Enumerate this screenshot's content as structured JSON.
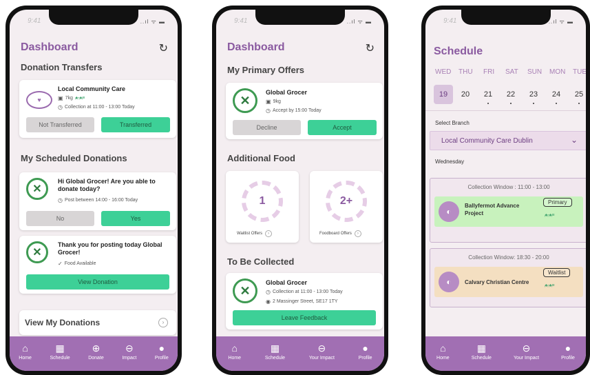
{
  "status": {
    "time": "9:41",
    "signal": "..ıl ᯤ ▬"
  },
  "phone1": {
    "title": "Dashboard",
    "section_transfers": "Donation Transfers",
    "transfer_card": {
      "name": "Local Community Care",
      "weight": "7kg",
      "collection": "Collection at 11:00 - 13:00 Today",
      "btn_not": "Not Transferred",
      "btn_yes": "Transferred"
    },
    "section_scheduled": "My Scheduled Donations",
    "scheduled_card1": {
      "title": "Hi Global Grocer! Are you able to donate today?",
      "line": "Post between 14:00 - 16:00 Today",
      "btn_no": "No",
      "btn_yes": "Yes"
    },
    "scheduled_card2": {
      "title": "Thank you for posting today Global Grocer!",
      "line": "Food Available",
      "btn": "View Donation"
    },
    "view_my": "View My Donations",
    "tabs": [
      "Home",
      "Schedule",
      "Donate",
      "Impact",
      "Profile"
    ]
  },
  "phone2": {
    "title": "Dashboard",
    "section_primary": "My Primary Offers",
    "offer_card": {
      "name": "Global Grocer",
      "weight": "9kg",
      "accept_by": "Accept by 15:00 Today",
      "btn_decline": "Decline",
      "btn_accept": "Accept"
    },
    "section_additional": "Additional Food",
    "waitlist": {
      "count": "1",
      "label": "Waitlist Offers"
    },
    "foodboard": {
      "count": "2+",
      "label": "Foodboard Offers"
    },
    "section_collect": "To Be Collected",
    "collect_card": {
      "name": "Global Grocer",
      "collection": "Collection at 11:00 - 13:00 Today",
      "address": "2 Massinger Street, SE17 1TY",
      "btn": "Leave Feedback"
    },
    "tabs": [
      "Home",
      "Schedule",
      "Your Impact",
      "Profile"
    ]
  },
  "phone3": {
    "title": "Schedule",
    "days": [
      "WED",
      "THU",
      "FRI",
      "SAT",
      "SUN",
      "MON",
      "TUE"
    ],
    "dates": [
      "19",
      "20",
      "21",
      "22",
      "23",
      "24",
      "25"
    ],
    "select_label": "Select Branch",
    "branch": "Local Community Care Dublin",
    "weekday": "Wednesday",
    "window1": {
      "label": "Collection Window : 11:00 - 13:00",
      "org": "Ballyfermot Advance Project",
      "tag": "Primary"
    },
    "window2": {
      "label": "Collection Window: 18:30 - 20:00",
      "org": "Calvary Christian Centre",
      "tag": "Waitlist"
    },
    "tabs": [
      "Home",
      "Schedule",
      "Your Impact",
      "Profile"
    ]
  },
  "colors": {
    "accent_purple": "#a16fb3",
    "title_purple": "#8a5aa0",
    "green_button": "#3dd097",
    "primary_card": "#c8f2bd",
    "waitlist_card": "#f4dfc1"
  }
}
